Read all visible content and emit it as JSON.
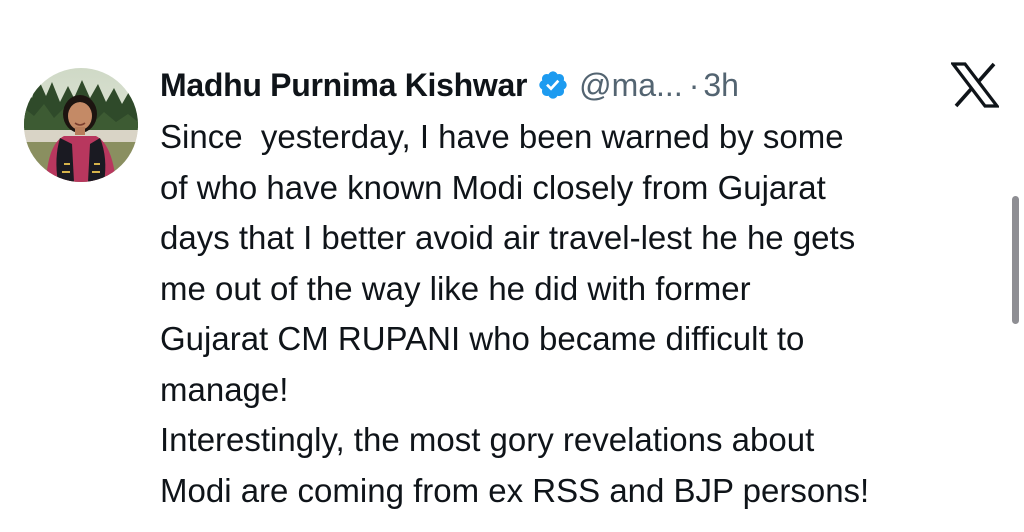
{
  "tweet": {
    "author": {
      "display_name": "Madhu Purnima Kishwar",
      "handle": "@ma...",
      "verified": true,
      "avatar": "profile-photo"
    },
    "separator": "·",
    "time": "3h",
    "platform_icon": "x-logo-icon",
    "text_lines": [
      "Since  yesterday, I have been warned by some",
      "of who have known Modi closely from Gujarat",
      "days that I better avoid air travel-lest he he gets",
      "me out of the way like he did with former",
      "Gujarat CM RUPANI who became difficult to",
      "manage!",
      "Interestingly, the most gory revelations about",
      "Modi are coming from ex RSS and BJP persons!"
    ]
  },
  "colors": {
    "text": "#0f1419",
    "secondary_text": "#536471",
    "verified_badge": "#1d9bf0",
    "background": "#ffffff",
    "scrollbar": "#8e8e93"
  }
}
